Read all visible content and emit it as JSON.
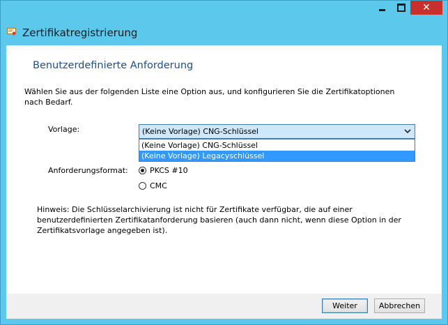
{
  "window": {
    "title": "Zertifikatregistrierung",
    "controls": {
      "minimize": "minimize",
      "maximize": "maximize",
      "close": "✕"
    }
  },
  "page": {
    "heading": "Benutzerdefinierte Anforderung",
    "intro": "Wählen Sie aus der folgenden Liste eine Option aus, und konfigurieren Sie die Zertifikatoptionen nach Bedarf.",
    "template_label": "Vorlage:",
    "template_select": {
      "selected": "(Keine Vorlage) CNG-Schlüssel",
      "options": [
        "(Keine Vorlage) CNG-Schlüssel",
        "(Keine Vorlage) Legacyschlüssel"
      ],
      "highlighted_option": "(Keine Vorlage) Legacyschlüssel"
    },
    "format_label": "Anforderungsformat:",
    "format_options": [
      {
        "label": "PKCS #10",
        "checked": true
      },
      {
        "label": "CMC",
        "checked": false
      }
    ],
    "hint": "Hinweis: Die Schlüsselarchivierung ist nicht für Zertifikate verfügbar, die auf einer benutzerdefinierten Zertifikatanforderung basieren (auch dann nicht, wenn diese Option in der Zertifikatsvorlage angegeben ist)."
  },
  "buttons": {
    "next": "Weiter",
    "cancel": "Abbrechen"
  },
  "colors": {
    "window_frame": "#5bc8ec",
    "close_button": "#c7302b",
    "heading": "#1f4f8a",
    "selection": "#3399ff"
  },
  "icons": {
    "window_icon": "certificate-icon",
    "dropdown": "chevron-down-icon"
  }
}
